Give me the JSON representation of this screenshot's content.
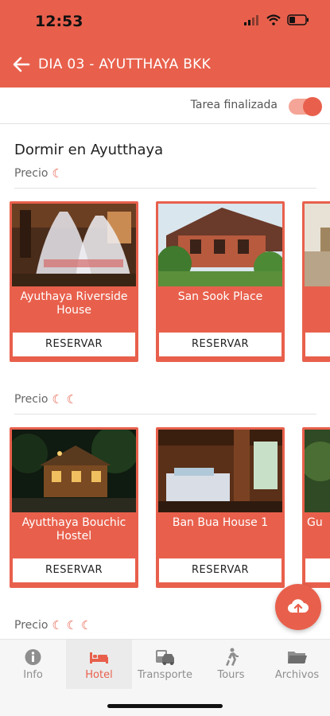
{
  "status_bar": {
    "time": "12:53"
  },
  "header": {
    "title": "DIA 03 - AYUTTHAYA BKK"
  },
  "task": {
    "label": "Tarea finalizada",
    "completed": true
  },
  "section": {
    "title": "Dormir en Ayutthaya"
  },
  "price_label": "Precio",
  "price_symbol": "☾",
  "price_groups": [
    {
      "symbols": "☾",
      "hotels": [
        {
          "name": "Ayuthaya Riverside House",
          "button": "RESERVAR"
        },
        {
          "name": "San Sook Place",
          "button": "RESERVAR"
        },
        {
          "name": "",
          "button": ""
        }
      ]
    },
    {
      "symbols": "☾ ☾",
      "hotels": [
        {
          "name": "Ayutthaya Bouchic Hostel",
          "button": "RESERVAR"
        },
        {
          "name": "Ban Bua House 1",
          "button": "RESERVAR"
        },
        {
          "name": "Gu",
          "button": ""
        }
      ]
    },
    {
      "symbols": "☾ ☾ ☾",
      "hotels": []
    }
  ],
  "tabs": [
    {
      "label": "Info",
      "icon": "info-icon",
      "active": false
    },
    {
      "label": "Hotel",
      "icon": "bed-icon",
      "active": true
    },
    {
      "label": "Transporte",
      "icon": "car-icon",
      "active": false
    },
    {
      "label": "Tours",
      "icon": "walking-person-icon",
      "active": false
    },
    {
      "label": "Archivos",
      "icon": "folder-icon",
      "active": false
    }
  ],
  "colors": {
    "accent": "#e8604c",
    "accent_light": "#f4a597",
    "tab_inactive": "#8e8e8e"
  }
}
